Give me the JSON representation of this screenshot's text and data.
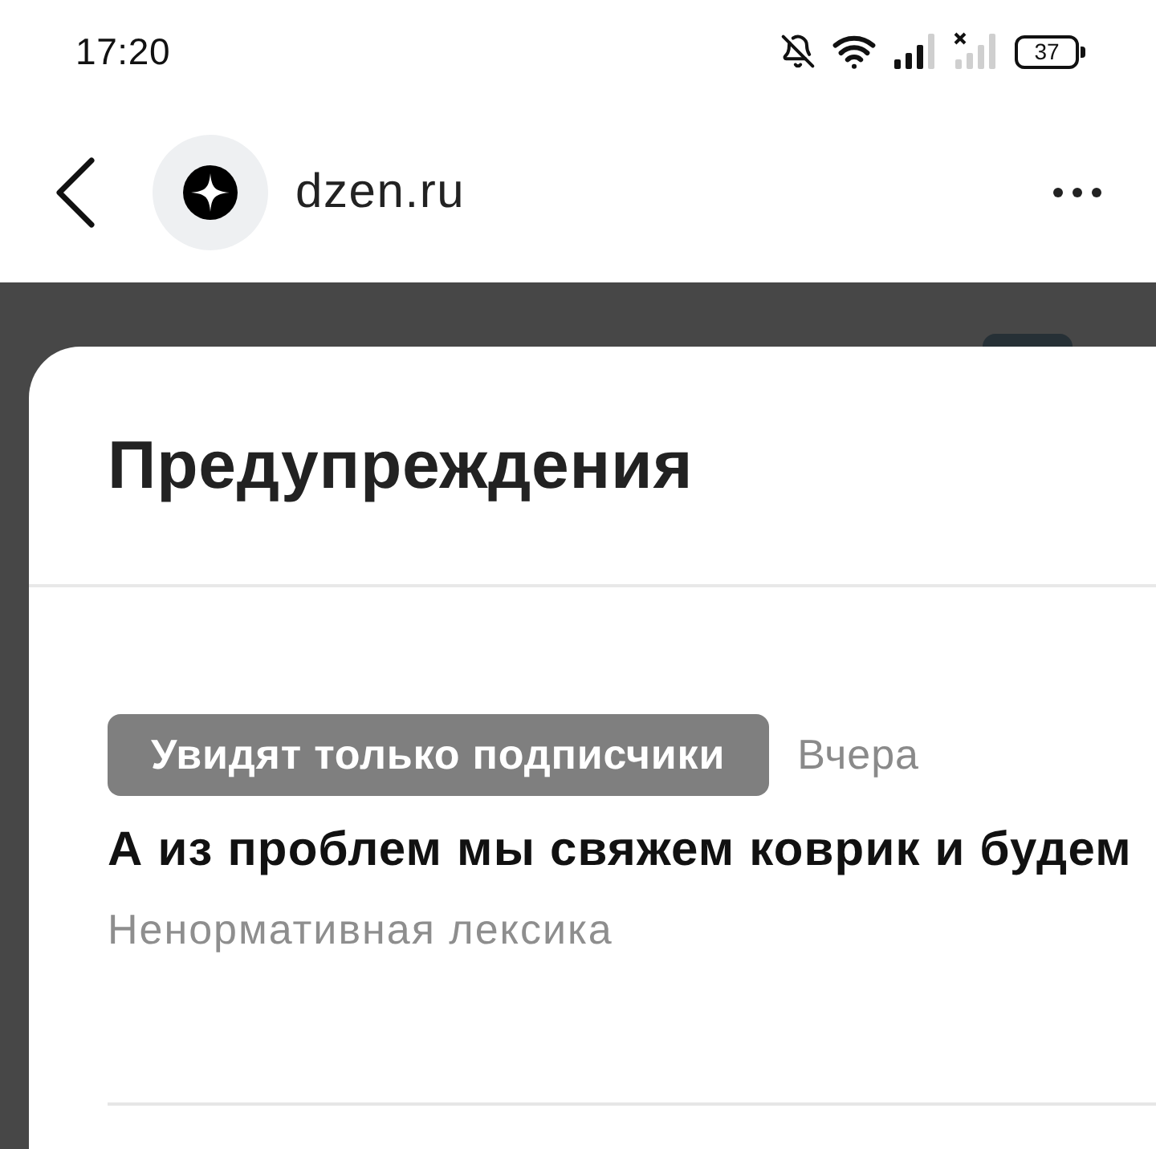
{
  "status_bar": {
    "time": "17:20",
    "battery": "37"
  },
  "browser_bar": {
    "domain": "dzen.ru"
  },
  "sheet": {
    "title": "Предупреждения",
    "warnings": [
      {
        "audience_badge": "Увидят только подписчики",
        "date": "Вчера",
        "post_title": "А из проблем мы свяжем коврик и будем",
        "reason": "Ненормативная лексика"
      }
    ]
  }
}
